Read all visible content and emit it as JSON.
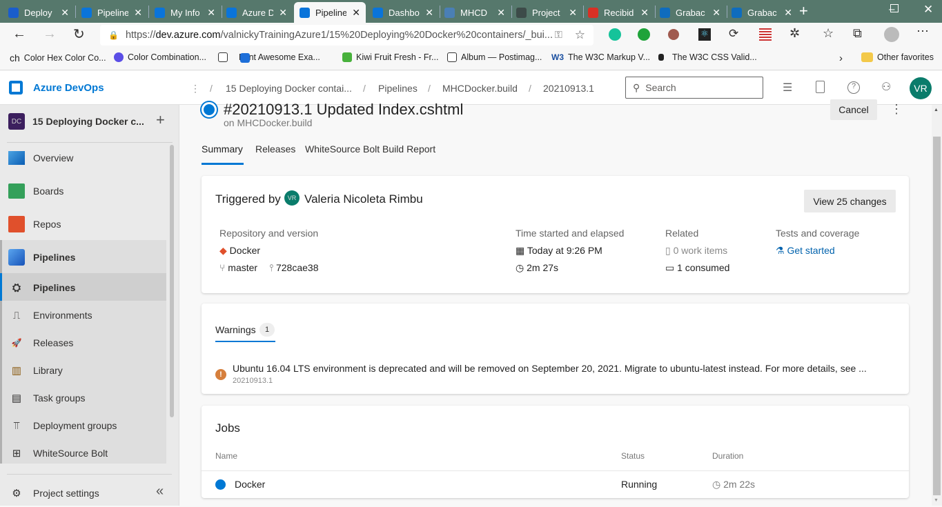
{
  "browser": {
    "tabs": [
      {
        "label": "Deploy",
        "color": "#1a5dcc"
      },
      {
        "label": "Pipeline",
        "color": "#0a74da"
      },
      {
        "label": "My Info",
        "color": "#0a74da"
      },
      {
        "label": "Azure D",
        "color": "#0a74da"
      },
      {
        "label": "Pipeline",
        "color": "#0a74da",
        "active": true
      },
      {
        "label": "Dashbo",
        "color": "#0a74da"
      },
      {
        "label": "MHCD",
        "color": "#4a7fb5"
      },
      {
        "label": "Project",
        "color": "#3d4b49"
      },
      {
        "label": "Recibid",
        "color": "#d93025"
      },
      {
        "label": "Grabac",
        "color": "#0f6cbd"
      },
      {
        "label": "Grabac",
        "color": "#0f6cbd"
      }
    ],
    "url_prefix": "https://",
    "url_host": "dev.azure.com",
    "url_rest": "/valnickyTrainingAzure1/15%20Deploying%20Docker%20containers/_bui...",
    "bookmarks": [
      "Color Hex Color Co...",
      "Color Combination...",
      "Font Awesome Exa...",
      "Kiwi Fruit Fresh - Fr...",
      "Album — Postimag...",
      "The W3C Markup V...",
      "The W3C CSS Valid..."
    ],
    "other_favorites": "Other favorites"
  },
  "app": {
    "brand": "Azure DevOps",
    "breadcrumbs": [
      "15 Deploying Docker contai...",
      "Pipelines",
      "MHCDocker.build",
      "20210913.1"
    ],
    "search_placeholder": "Search",
    "avatar": "VR",
    "accent": "#0078d4"
  },
  "sidebar": {
    "project_initials": "DC",
    "project_name": "15 Deploying Docker c...",
    "items": [
      {
        "label": "Overview",
        "icon": "overview-icon"
      },
      {
        "label": "Boards",
        "icon": "boards-icon"
      },
      {
        "label": "Repos",
        "icon": "repos-icon"
      },
      {
        "label": "Pipelines",
        "icon": "pipelines-icon"
      }
    ],
    "sub_items": [
      {
        "label": "Pipelines",
        "glyph": "⛭",
        "selected": true
      },
      {
        "label": "Environments",
        "glyph": "⎍"
      },
      {
        "label": "Releases",
        "glyph": "🚀"
      },
      {
        "label": "Library",
        "glyph": "▥"
      },
      {
        "label": "Task groups",
        "glyph": "▤"
      },
      {
        "label": "Deployment groups",
        "glyph": "⫪"
      },
      {
        "label": "WhiteSource Bolt",
        "glyph": "⊞"
      }
    ],
    "settings": "Project settings"
  },
  "run": {
    "title": "#20210913.1 Updated Index.cshtml",
    "subtitle": "on MHCDocker.build",
    "cancel": "Cancel",
    "tabs": [
      "Summary",
      "Releases",
      "WhiteSource Bolt Build Report"
    ],
    "triggered_by": "Triggered by",
    "user_initials": "VR",
    "user": "Valeria Nicoleta Rimbu",
    "view_changes": "View 25 changes",
    "repo_label": "Repository and version",
    "repo": "Docker",
    "branch": "master",
    "commit": "728cae38",
    "time_label": "Time started and elapsed",
    "started": "Today at 9:26 PM",
    "elapsed": "2m 27s",
    "related_label": "Related",
    "work_items": "0 work items",
    "consumed": "1 consumed",
    "tests_label": "Tests and coverage",
    "get_started": "Get started"
  },
  "warnings": {
    "tab": "Warnings",
    "count": "1",
    "message": "Ubuntu 16.04 LTS environment is deprecated and will be removed on September 20, 2021. Migrate to ubuntu-latest instead. For more details, see ...",
    "source": "20210913.1"
  },
  "jobs": {
    "title": "Jobs",
    "columns": [
      "Name",
      "Status",
      "Duration"
    ],
    "rows": [
      {
        "name": "Docker",
        "status": "Running",
        "duration": "2m 22s"
      }
    ]
  }
}
